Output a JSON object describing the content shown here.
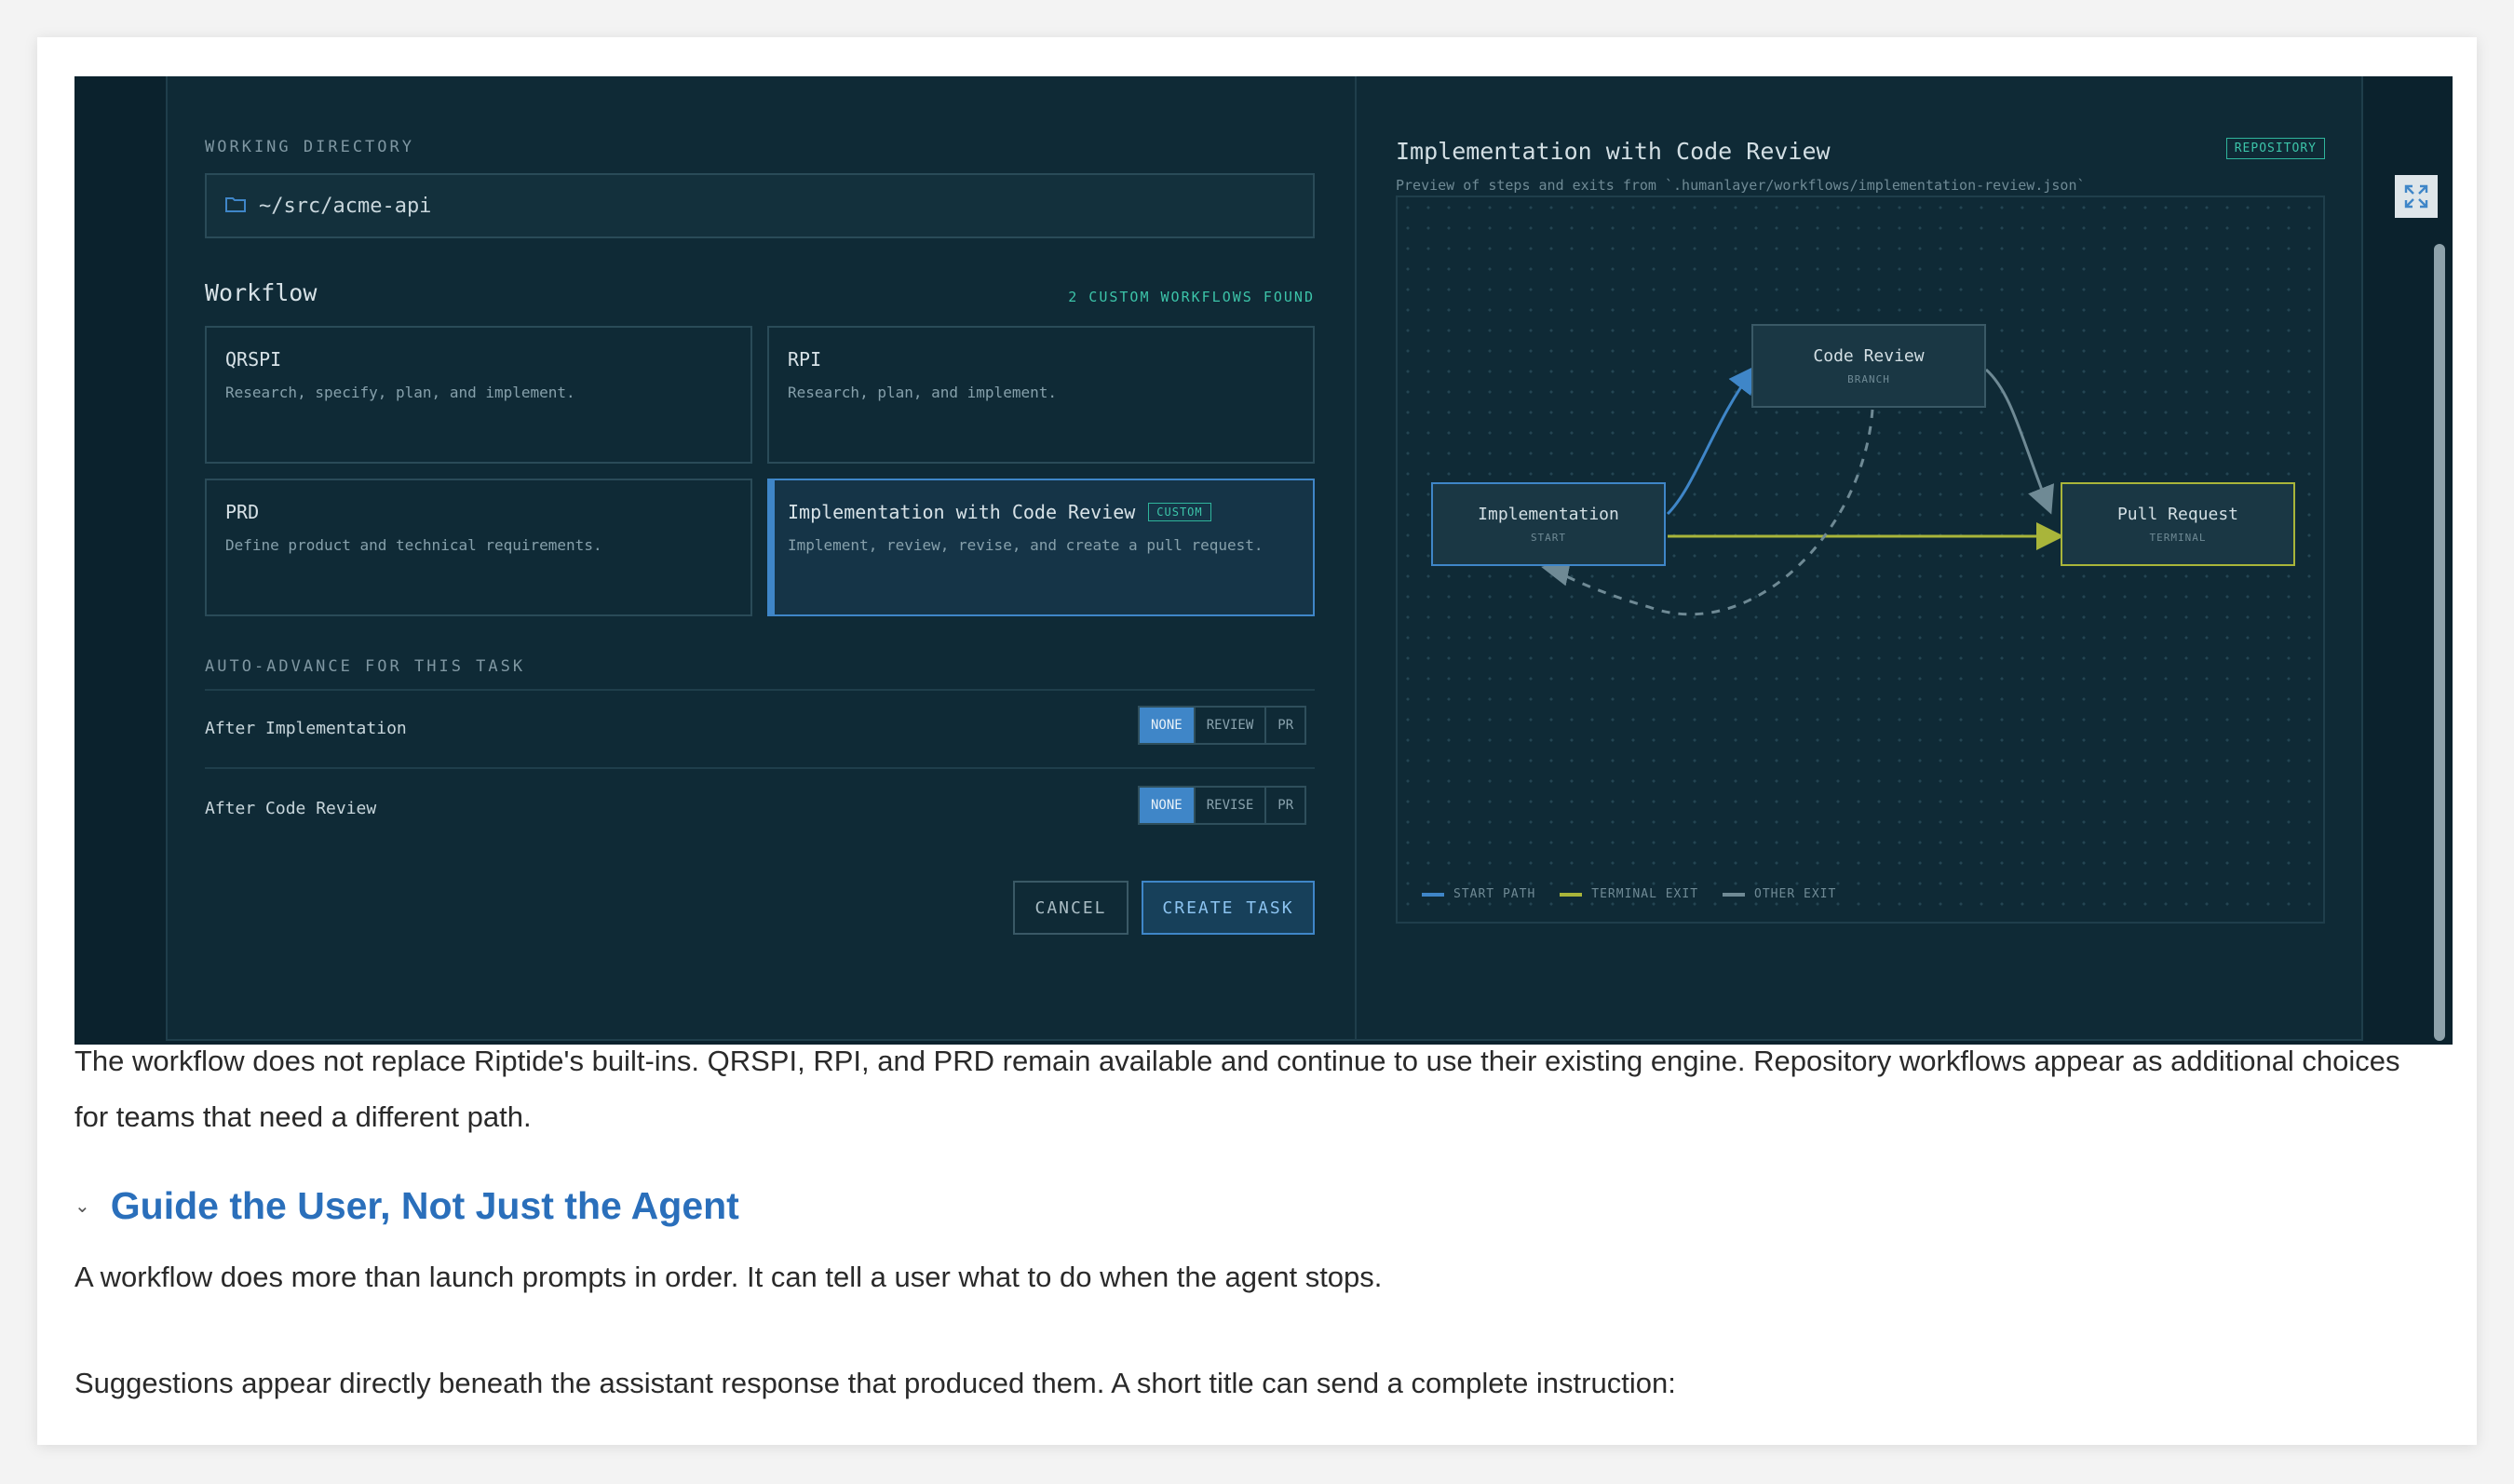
{
  "modal": {
    "working_directory_label": "WORKING DIRECTORY",
    "working_directory_value": "~/src/acme-api",
    "workflow_label": "Workflow",
    "custom_found": "2 CUSTOM WORKFLOWS FOUND",
    "workflows": [
      {
        "title": "QRSPI",
        "desc": "Research, specify, plan, and implement."
      },
      {
        "title": "RPI",
        "desc": "Research, plan, and implement."
      },
      {
        "title": "PRD",
        "desc": "Define product and technical requirements."
      },
      {
        "title": "Implementation with Code Review",
        "desc": "Implement, review, revise, and create a pull request.",
        "badge": "CUSTOM"
      }
    ],
    "auto_advance_label": "AUTO-ADVANCE FOR THIS TASK",
    "advance_rows": [
      {
        "label": "After Implementation",
        "options": [
          "NONE",
          "REVIEW",
          "PR"
        ],
        "selected": "NONE"
      },
      {
        "label": "After Code Review",
        "options": [
          "NONE",
          "REVISE",
          "PR"
        ],
        "selected": "NONE"
      }
    ],
    "cancel": "CANCEL",
    "create": "CREATE TASK"
  },
  "preview": {
    "title": "Implementation with Code Review",
    "badge": "REPOSITORY",
    "subtitle": "Preview of steps and exits from `.humanlayer/workflows/implementation-review.json`",
    "nodes": {
      "implementation": {
        "name": "Implementation",
        "kind": "START"
      },
      "code_review": {
        "name": "Code Review",
        "kind": "BRANCH"
      },
      "pull_request": {
        "name": "Pull Request",
        "kind": "TERMINAL"
      }
    },
    "legend": [
      "START PATH",
      "TERMINAL EXIT",
      "OTHER EXIT"
    ],
    "colors": {
      "start": "#3f86c8",
      "terminal": "#a9b53a",
      "other": "#6f8a95"
    }
  },
  "article": {
    "para1": "The workflow does not replace Riptide's built-ins. QRSPI, RPI, and PRD remain available and continue to use their existing engine. Repository workflows appear as additional choices for teams that need a different path.",
    "heading": "Guide the User, Not Just the Agent",
    "para2": "A workflow does more than launch prompts in order. It can tell a user what to do when the agent stops.",
    "para3": "Suggestions appear directly beneath the assistant response that produced them. A short title can send a complete instruction:"
  }
}
